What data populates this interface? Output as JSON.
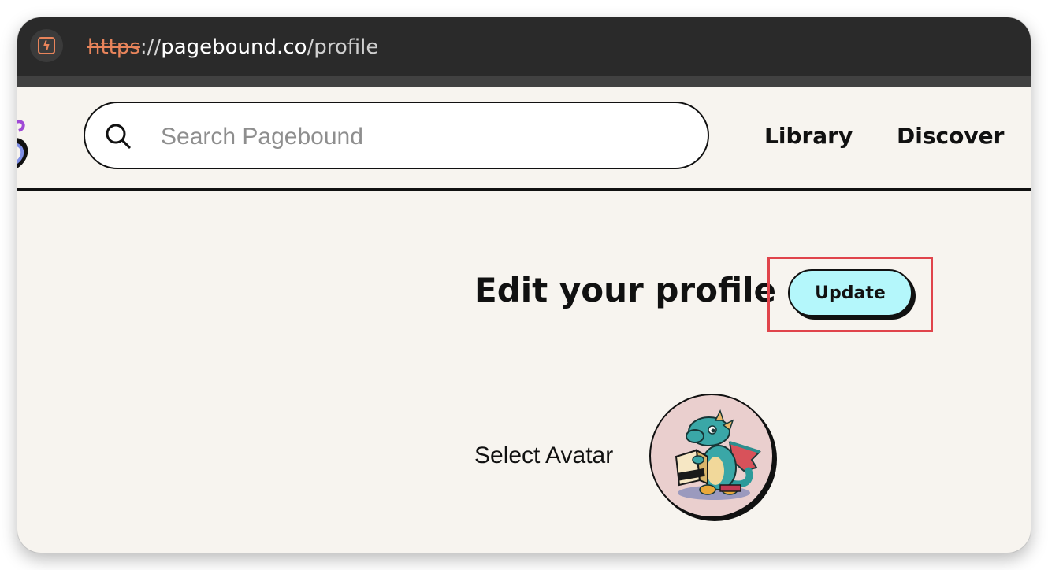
{
  "browser": {
    "url_scheme": "https",
    "url_separator": "://",
    "url_host": "pagebound.co",
    "url_path": "/profile",
    "site_icon": "lightning-bolt-icon",
    "site_icon_color": "#e8845b"
  },
  "header": {
    "search": {
      "placeholder": "Search Pagebound",
      "value": "",
      "icon": "search-icon"
    },
    "nav": {
      "library": "Library",
      "discover": "Discover"
    }
  },
  "main": {
    "title": "Edit your profile",
    "update_label": "Update",
    "update_color": "#b4f7fb",
    "highlight_color": "#e0444b",
    "avatar_label": "Select Avatar",
    "avatar_image": "dragon-reading-book-avatar"
  }
}
